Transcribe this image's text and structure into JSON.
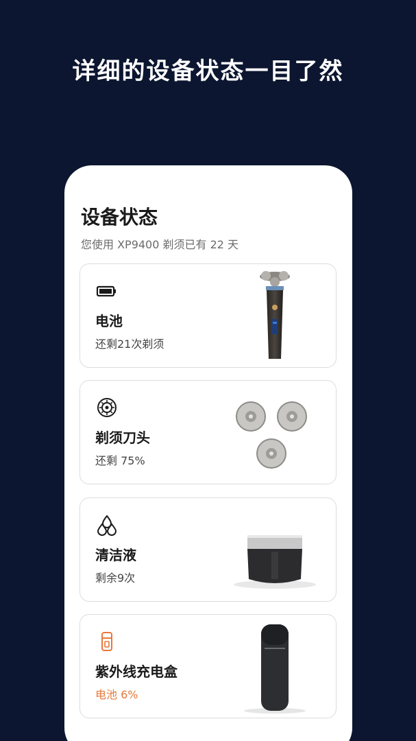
{
  "headline": "详细的设备状态一目了然",
  "device_status": {
    "title": "设备状态",
    "subtitle": "您使用 XP9400 剃须已有 22 天",
    "cards": [
      {
        "name": "电池",
        "status": "还剩21次剃须",
        "icon": "battery-icon"
      },
      {
        "name": "剃须刀头",
        "status": "还剩 75%",
        "icon": "blade-head-icon"
      },
      {
        "name": "清洁液",
        "status": "剩余9次",
        "icon": "cleaning-fluid-icon"
      },
      {
        "name": "紫外线充电盒",
        "status": "电池 6%",
        "icon": "uv-charging-box-icon"
      }
    ]
  },
  "colors": {
    "background": "#0c1630",
    "warning": "#e8773a",
    "card_border": "#dcdcdc"
  }
}
